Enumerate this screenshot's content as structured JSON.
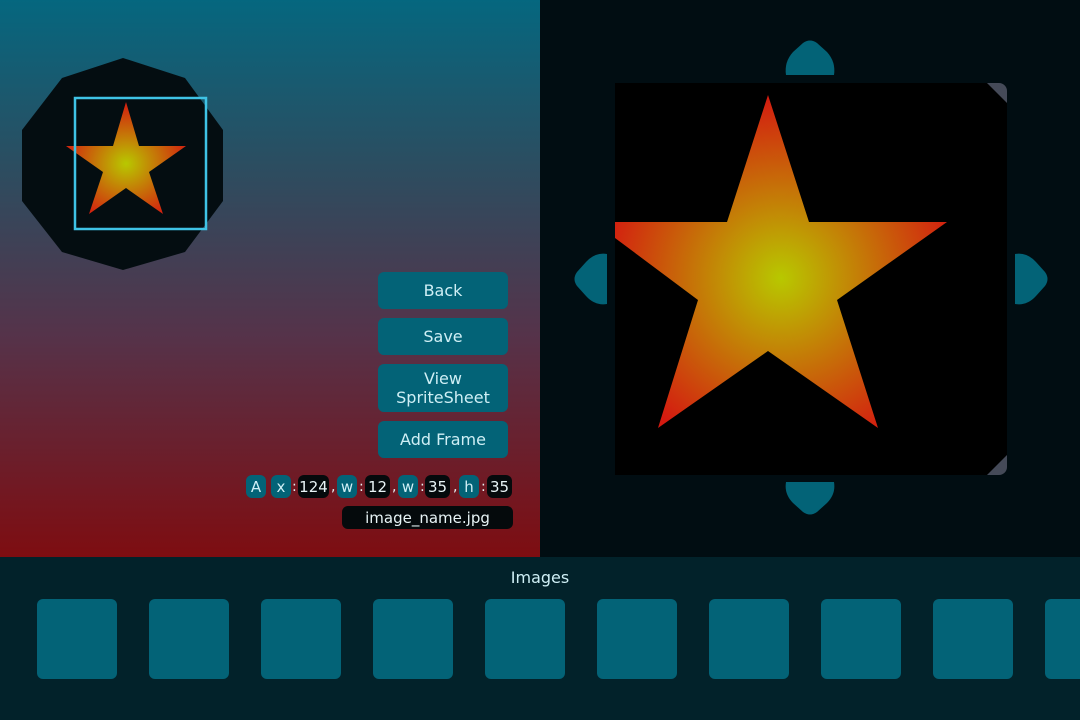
{
  "preview": {
    "shape": "decagon",
    "sprite": "star",
    "selection": "rectangle"
  },
  "buttons": {
    "back": "Back",
    "save": "Save",
    "view_spritesheet": "View SpriteSheet",
    "add_frame": "Add Frame"
  },
  "frame_info": {
    "anchor_label": "A",
    "x_label": "x",
    "x_value": "124",
    "w1_label": "w",
    "w1_value": "12",
    "w2_label": "w",
    "w2_value": "35",
    "h_label": "h",
    "h_value": "35",
    "colon": ":",
    "comma": ","
  },
  "image_name": "image_name.jpg",
  "viewer": {
    "arrows": [
      "up",
      "down",
      "left",
      "right"
    ]
  },
  "images": {
    "title": "Images",
    "thumbnail_count": 10
  },
  "colors": {
    "accent": "#036377",
    "selection_border": "#3fc3e6",
    "star_center": "#b8c800",
    "star_edge": "#d41a10",
    "dark_bg": "#010d12",
    "bottom_bg": "#02222a"
  }
}
